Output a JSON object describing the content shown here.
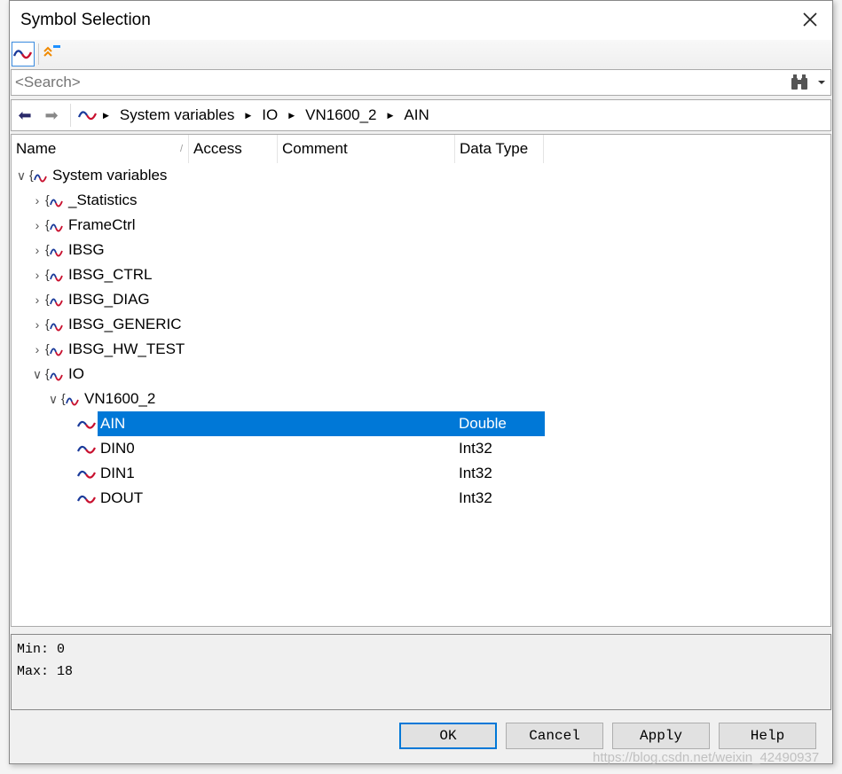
{
  "dialog": {
    "title": "Symbol Selection"
  },
  "toolbar": {
    "symbol_icon": "sine-wave-icon",
    "collapse_icon": "collapse-up-icon"
  },
  "search": {
    "placeholder": "<Search>",
    "value": ""
  },
  "breadcrumb": [
    "System variables",
    "IO",
    "VN1600_2",
    "AIN"
  ],
  "columns": [
    "Name",
    "Access",
    "Comment",
    "Data Type"
  ],
  "tree": [
    {
      "label": "System variables",
      "level": 0,
      "expanded": true,
      "ns": true
    },
    {
      "label": "_Statistics",
      "level": 1,
      "expanded": false,
      "ns": true
    },
    {
      "label": "FrameCtrl",
      "level": 1,
      "expanded": false,
      "ns": true
    },
    {
      "label": "IBSG",
      "level": 1,
      "expanded": false,
      "ns": true
    },
    {
      "label": "IBSG_CTRL",
      "level": 1,
      "expanded": false,
      "ns": true
    },
    {
      "label": "IBSG_DIAG",
      "level": 1,
      "expanded": false,
      "ns": true
    },
    {
      "label": "IBSG_GENERIC",
      "level": 1,
      "expanded": false,
      "ns": true
    },
    {
      "label": "IBSG_HW_TEST",
      "level": 1,
      "expanded": false,
      "ns": true
    },
    {
      "label": "IO",
      "level": 1,
      "expanded": true,
      "ns": true
    },
    {
      "label": "VN1600_2",
      "level": 2,
      "expanded": true,
      "ns": true
    },
    {
      "label": "AIN",
      "level": 3,
      "type": "Double",
      "selected": true
    },
    {
      "label": "DIN0",
      "level": 3,
      "type": "Int32"
    },
    {
      "label": "DIN1",
      "level": 3,
      "type": "Int32"
    },
    {
      "label": "DOUT",
      "level": 3,
      "type": "Int32"
    }
  ],
  "info": {
    "min": "Min:  0",
    "max": "Max:  18"
  },
  "buttons": {
    "ok": "OK",
    "cancel": "Cancel",
    "apply": "Apply",
    "help": "Help"
  },
  "watermark": "https://blog.csdn.net/weixin_42490937",
  "colors": {
    "selection": "#0078d7",
    "accent": "#3c8ce0"
  }
}
